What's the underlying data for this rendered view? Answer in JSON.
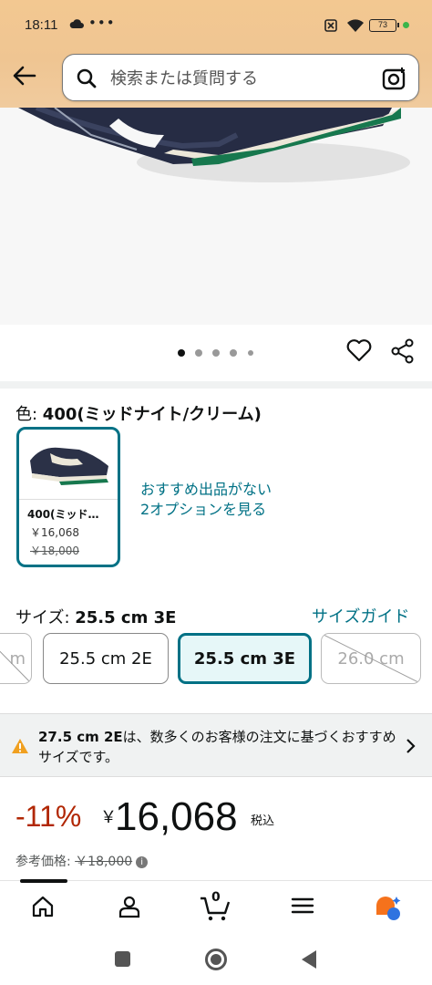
{
  "status_bar": {
    "time": "18:11",
    "dots": "•••",
    "battery": "73"
  },
  "search": {
    "placeholder": "検索または質問する"
  },
  "carousel": {
    "image_count": 5,
    "active_index": 0
  },
  "color": {
    "label": "色: ",
    "value": "400(ミッドナイト/クリーム)",
    "swatch_name": "400(ミッド…",
    "swatch_price": "￥16,068",
    "swatch_list_price": "￥18,000",
    "more_options": [
      "おすすめ出品がない",
      "2オプションを見る"
    ]
  },
  "size": {
    "label": "サイズ: ",
    "value": "25.5 cm 3E",
    "guide": "サイズガイド",
    "options": [
      {
        "label": "m",
        "state": "unavailable"
      },
      {
        "label": "25.5 cm 2E",
        "state": "available"
      },
      {
        "label": "25.5 cm 3E",
        "state": "selected"
      },
      {
        "label": "26.0 cm",
        "state": "unavailable"
      }
    ]
  },
  "notice": {
    "bold": "27.5 cm 2E",
    "text": "は、数多くのお客様の注文に基づくおすすめサイズです。"
  },
  "price": {
    "discount": "-11%",
    "currency": "￥",
    "amount": "16,068",
    "tax": "税込",
    "ref_label": "参考価格: ",
    "ref_value": "￥18,000"
  },
  "tabbar": {
    "cart_count": "0"
  },
  "colors": {
    "accent": "#007185",
    "discount": "#b12704",
    "header": "#f3c891"
  }
}
